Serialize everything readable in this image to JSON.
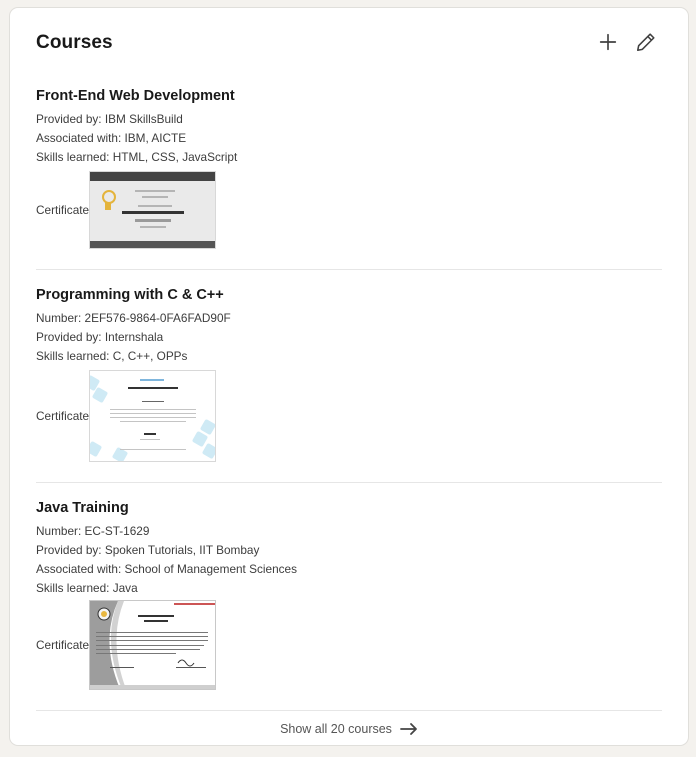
{
  "section": {
    "title": "Courses",
    "add_icon": "plus-icon",
    "edit_icon": "pencil-icon"
  },
  "courses": [
    {
      "name": "Front-End Web Development",
      "lines": [
        "Provided by: IBM SkillsBuild",
        "Associated with: IBM, AICTE",
        "Skills learned: HTML, CSS, JavaScript"
      ],
      "certificate_label": "Certificate:"
    },
    {
      "name": "Programming with C & C++",
      "lines": [
        "Number: 2EF576-9864-0FA6FAD90F",
        "Provided by: Internshala",
        "Skills learned: C, C++, OPPs"
      ],
      "certificate_label": "Certificate:"
    },
    {
      "name": "Java Training",
      "lines": [
        "Number: EC-ST-1629",
        "Provided by: Spoken Tutorials, IIT Bombay",
        "Associated with: School of Management Sciences",
        "Skills learned: Java"
      ],
      "certificate_label": "Certificate:"
    }
  ],
  "footer": {
    "show_all_label": "Show all 20 courses",
    "arrow_icon": "arrow-right-icon"
  },
  "colors": {
    "page_bg": "#f4f2ee",
    "card_bg": "#ffffff",
    "text_primary": "#191919",
    "text_secondary": "#3d3d3d"
  }
}
